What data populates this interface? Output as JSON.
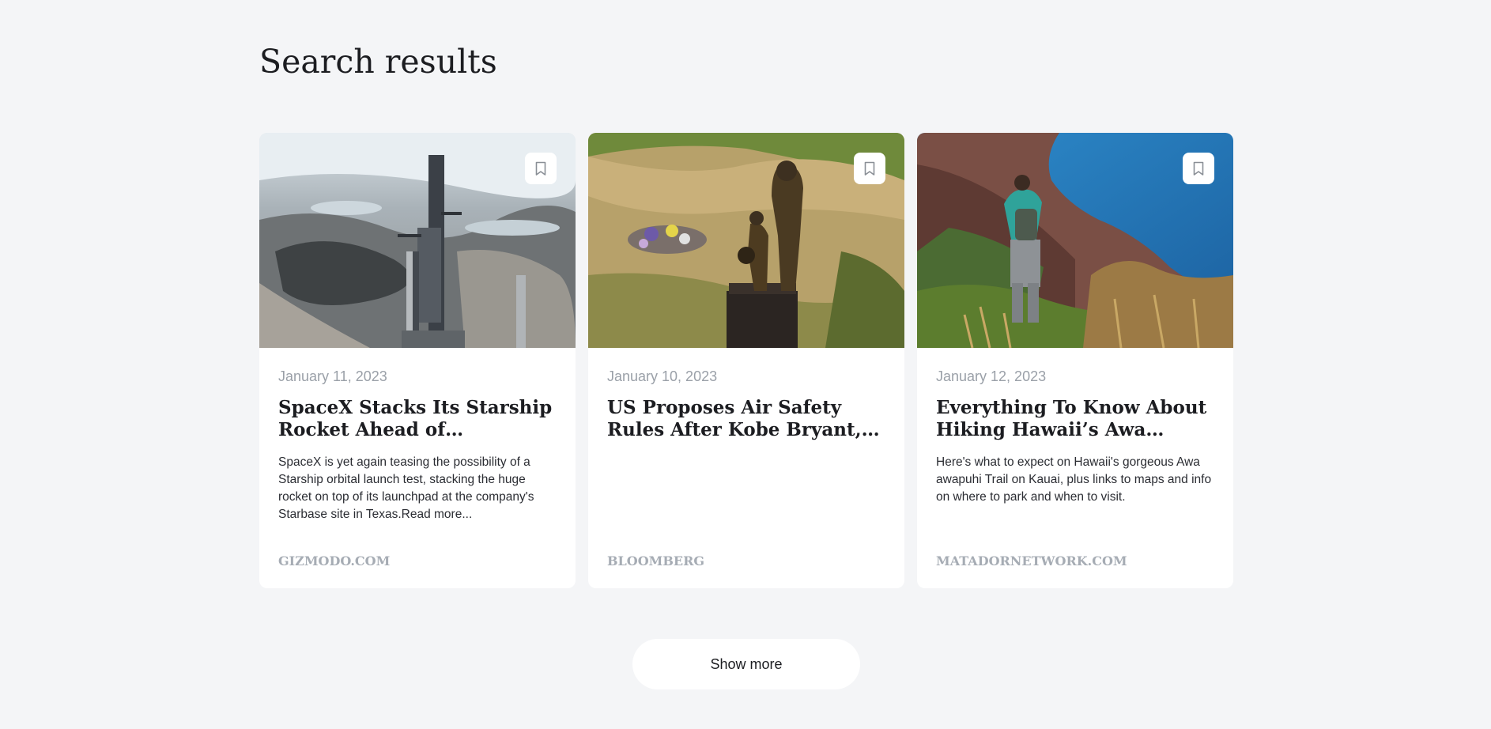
{
  "page": {
    "title": "Search results"
  },
  "cards": [
    {
      "date": "January 11, 2023",
      "title": "SpaceX Stacks Its Starship Rocket Ahead of Anticipated Orbital Launch Test",
      "description": "SpaceX is yet again teasing the possibility of a Starship orbital launch test, stacking the huge rocket on top of its launchpad at the company's Starbase site in Texas.Read more...",
      "source": "GIZMODO.COM",
      "image_icon": "starship-launchpad-photo",
      "bookmark_icon": "bookmark-icon"
    },
    {
      "date": "January 10, 2023",
      "title": "US Proposes Air Safety Rules After Kobe Bryant, Charter Helicopter Crash",
      "description": "",
      "source": "BLOOMBERG",
      "image_icon": "kobe-bryant-statue-photo",
      "bookmark_icon": "bookmark-icon"
    },
    {
      "date": "January 12, 2023",
      "title": "Everything To Know About Hiking Hawaii’s Awa Awapuhi Trail",
      "description": "Here's what to expect on Hawaii's gorgeous Awa awapuhi Trail on Kauai, plus links to maps and info on where to park and when to visit.",
      "source": "MATADORNETWORK.COM",
      "image_icon": "hiker-coastline-photo",
      "bookmark_icon": "bookmark-icon"
    }
  ],
  "actions": {
    "show_more_label": "Show more"
  },
  "colors": {
    "background": "#f4f5f7",
    "card": "#ffffff",
    "date": "#9aa0a8",
    "source": "#a6acb4",
    "text": "#1c1d21"
  }
}
